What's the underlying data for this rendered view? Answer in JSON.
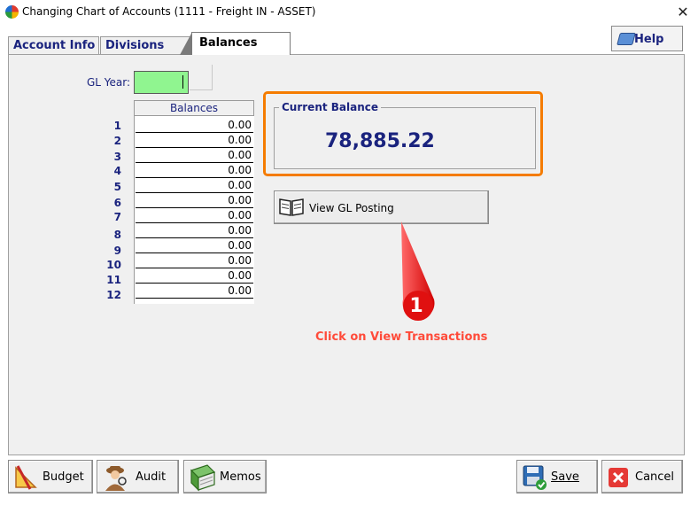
{
  "window": {
    "title": "Changing Chart of Accounts  (1111 - Freight IN - ASSET)",
    "close_glyph": "✕"
  },
  "tabs": [
    {
      "label": "Account Info"
    },
    {
      "label": "Divisions"
    },
    {
      "label": "Balances",
      "active": true
    }
  ],
  "help": {
    "label": "Help"
  },
  "gl_year": {
    "label": "GL Year:",
    "value": ""
  },
  "balances": {
    "header": "Balances",
    "rows": [
      {
        "period": "1",
        "value": "0.00"
      },
      {
        "period": "2",
        "value": "0.00"
      },
      {
        "period": "3",
        "value": "0.00"
      },
      {
        "period": "4",
        "value": "0.00"
      },
      {
        "period": "5",
        "value": "0.00"
      },
      {
        "period": "6",
        "value": "0.00"
      },
      {
        "period": "7",
        "value": "0.00"
      },
      {
        "period": "8",
        "value": "0.00"
      },
      {
        "period": "9",
        "value": "0.00"
      },
      {
        "period": "10",
        "value": "0.00"
      },
      {
        "period": "11",
        "value": "0.00"
      },
      {
        "period": "12",
        "value": "0.00"
      }
    ]
  },
  "current_balance": {
    "title": "Current Balance",
    "value": "78,885.22"
  },
  "view_gl": {
    "label": "View GL Posting"
  },
  "annotation": {
    "number": "1",
    "text": "Click on View Transactions"
  },
  "buttons": {
    "budget": "Budget",
    "audit": "Audit",
    "memos": "Memos",
    "save": "Save",
    "cancel": "Cancel"
  },
  "colors": {
    "accent_navy": "#1a237e",
    "highlight_orange": "#f57c00",
    "input_green": "#90f590",
    "callout_red": "#ff2a2a"
  }
}
